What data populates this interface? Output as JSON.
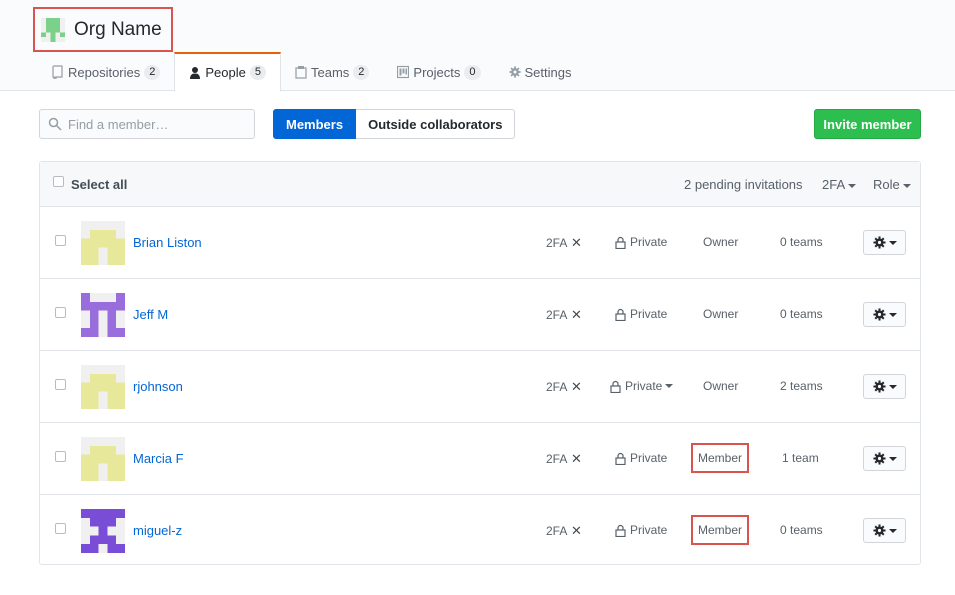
{
  "org": {
    "name": "Org Name",
    "avatar_icon": "org-identicon"
  },
  "tabs": [
    {
      "label": "Repositories",
      "count": "2",
      "icon": "repo-icon"
    },
    {
      "label": "People",
      "count": "5",
      "icon": "person-icon",
      "selected": true
    },
    {
      "label": "Teams",
      "count": "2",
      "icon": "team-icon"
    },
    {
      "label": "Projects",
      "count": "0",
      "icon": "project-icon"
    },
    {
      "label": "Settings",
      "icon": "gear-icon"
    }
  ],
  "search": {
    "placeholder": "Find a member…"
  },
  "filter": {
    "members": "Members",
    "outside": "Outside collaborators"
  },
  "invite_label": "Invite member",
  "table_header": {
    "select_all": "Select all",
    "pending": "2 pending invitations",
    "tfa": "2FA",
    "role": "Role"
  },
  "members": [
    {
      "name": "Brian Liston",
      "tfa": "2FA",
      "visibility": "Private",
      "visibility_dropdown": false,
      "role": "Owner",
      "role_highlight": false,
      "teams": "0 teams",
      "avatar_color": "#e8e89a"
    },
    {
      "name": "Jeff M",
      "tfa": "2FA",
      "visibility": "Private",
      "visibility_dropdown": false,
      "role": "Owner",
      "role_highlight": false,
      "teams": "0 teams",
      "avatar_color": "#9a6ddc"
    },
    {
      "name": "rjohnson",
      "tfa": "2FA",
      "visibility": "Private",
      "visibility_dropdown": true,
      "role": "Owner",
      "role_highlight": false,
      "teams": "2 teams",
      "avatar_color": "#e8e89a"
    },
    {
      "name": "Marcia F",
      "tfa": "2FA",
      "visibility": "Private",
      "visibility_dropdown": false,
      "role": "Member",
      "role_highlight": true,
      "teams": "1 team",
      "avatar_color": "#e8e89a"
    },
    {
      "name": "miguel-z",
      "tfa": "2FA",
      "visibility": "Private",
      "visibility_dropdown": false,
      "role": "Member",
      "role_highlight": true,
      "teams": "0 teams",
      "avatar_color": "#7a4dd6"
    }
  ],
  "colors": {
    "accent": "#0366d6",
    "invite": "#2cbe4e",
    "highlight": "#d9534f",
    "tab_underline": "#e36209"
  }
}
